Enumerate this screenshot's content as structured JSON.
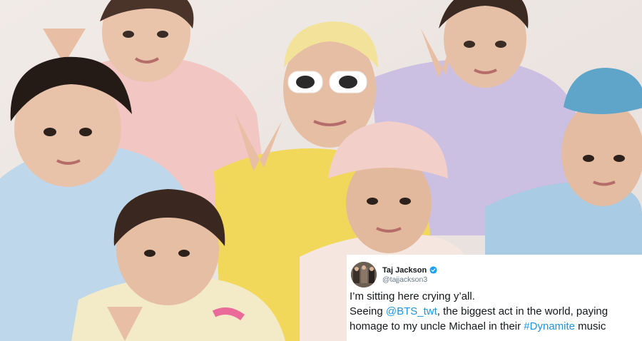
{
  "photo": {
    "palette": {
      "background": "#ede7e3",
      "skin": "#e8bfa5",
      "hair": "#2b201b",
      "pink_shirt": "#f1c6c3",
      "blue_shirt": "#bfd7ea",
      "yellow_shirt": "#f2d85a",
      "lavender_shirt": "#cbbfe2",
      "pink_hat": "#f2cfc9",
      "blue_hat": "#5fa5c9",
      "yellow_hat": "#f3e39a",
      "sunglasses": "#ffffff"
    }
  },
  "tweet": {
    "display_name": "Taj Jackson",
    "handle": "@tajjackson3",
    "verified_icon": "verified-badge-icon",
    "text": {
      "line1": "I’m sitting here crying y’all.",
      "line2_pre": "Seeing ",
      "line2_mention": "@BTS_twt",
      "line2_post": ", the biggest act in the world, paying",
      "line3_pre": "homage to my uncle Michael in their ",
      "line3_hashtag": "#Dynamite",
      "line3_post": " music"
    },
    "colors": {
      "link": "#1b95e0",
      "text": "#14171a",
      "muted": "#657786",
      "verified": "#1da1f2"
    }
  }
}
